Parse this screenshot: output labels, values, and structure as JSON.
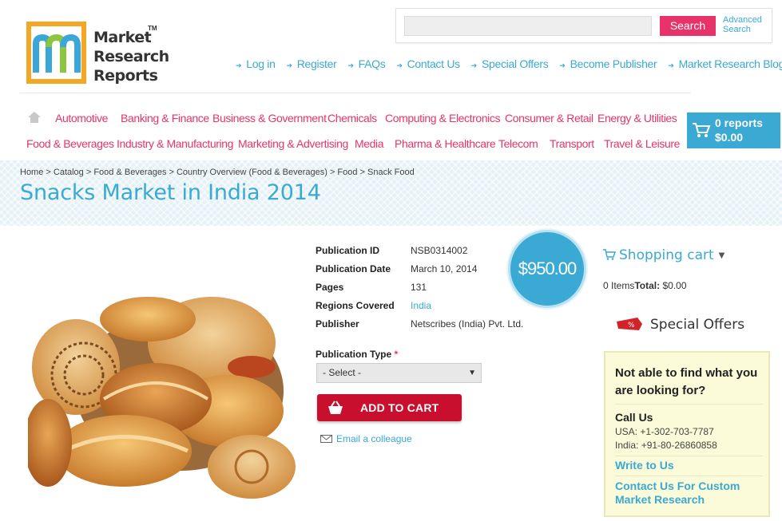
{
  "logo": {
    "lines": [
      "Market",
      "Research",
      "Reports"
    ],
    "tm": "TM"
  },
  "search": {
    "placeholder": "",
    "button": "Search",
    "advanced": "Advanced Search"
  },
  "top_links": [
    "Log in",
    "Register",
    "FAQs",
    "Contact Us",
    "Special Offers",
    "Become Publisher",
    "Market Research Blog"
  ],
  "categories_row1": [
    "Automotive",
    "Banking & Finance",
    "Business & Government",
    "Chemicals",
    "Computing & Electronics",
    "Consumer & Retail",
    "Energy & Utilities"
  ],
  "categories_row2": [
    "Food & Beverages",
    "Industry & Manufacturing",
    "Marketing & Advertising",
    "Media",
    "Pharma & Healthcare",
    "Telecom",
    "Transport",
    "Travel & Leisure"
  ],
  "cart_button": {
    "reports": "0 reports",
    "total": "$0.00"
  },
  "breadcrumb": "Home > Catalog > Food & Beverages > Country Overview (Food & Beverages) > Food > Snack Food",
  "title": "Snacks Market in India 2014",
  "details": [
    {
      "label": "Publication ID",
      "value": "NSB0314002",
      "link": false
    },
    {
      "label": "Publication Date",
      "value": "March 10, 2014",
      "link": false
    },
    {
      "label": "Pages",
      "value": "131",
      "link": false
    },
    {
      "label": "Regions Covered",
      "value": "India",
      "link": true
    },
    {
      "label": "Publisher",
      "value": "Netscribes (India) Pvt. Ltd.",
      "link": false
    }
  ],
  "price": "$950.00",
  "publication_type": {
    "label": "Publication Type",
    "required": "*",
    "selected": "- Select -"
  },
  "add_to_cart": "ADD TO CART",
  "email_colleague": "Email a colleague",
  "sidebar": {
    "cart_title": "Shopping cart",
    "items_label": "0 Items",
    "total_label": "Total:",
    "total_value": "$0.00",
    "special_offers": "Special Offers",
    "help_question": "Not able to find what you are looking for?",
    "call_us": "Call Us",
    "phone_usa": "USA: +1-302-703-7787",
    "phone_india": "India: +91-80-26860858",
    "write_to_us": "Write to Us",
    "contact_custom": "Contact Us For Custom Market Research"
  },
  "colors": {
    "brand_blue": "#3aa9d3",
    "brand_pink": "#e8336a",
    "cart_red": "#c8102e",
    "logo_orange": "#f5a623"
  }
}
